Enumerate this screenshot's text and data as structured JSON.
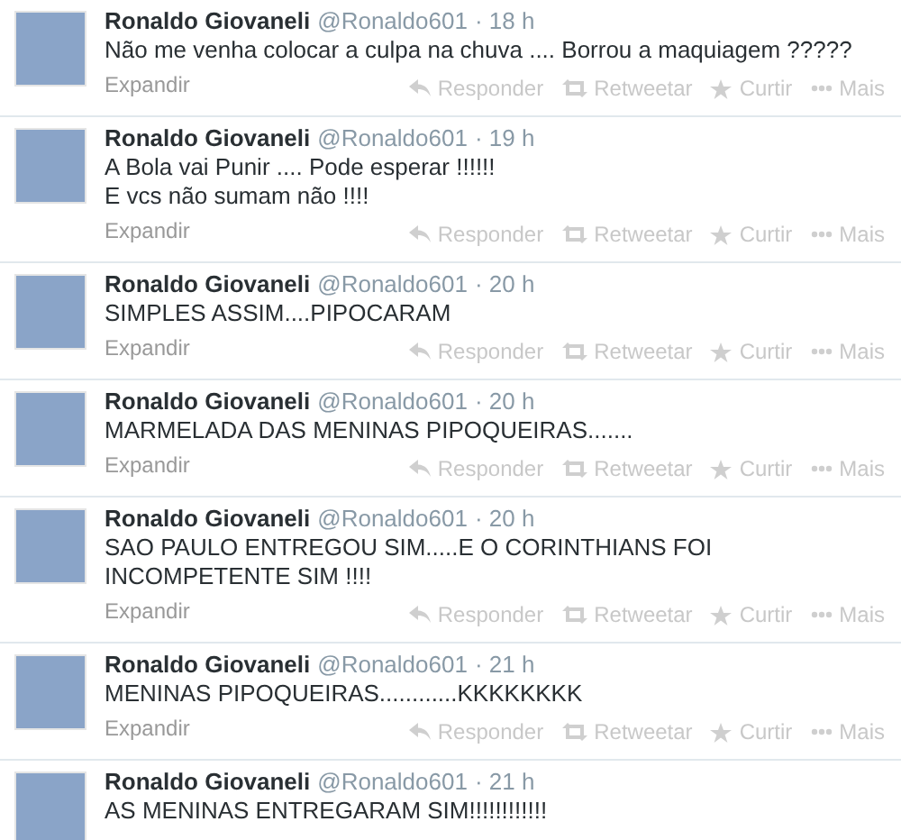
{
  "tweets": [
    {
      "name": "Ronaldo Giovaneli",
      "handle": "@Ronaldo601",
      "time": "· 18 h",
      "lines": [
        "Não me venha colocar a culpa na chuva .... Borrou a maquiagem ?????"
      ],
      "expand": "Expandir",
      "actions": [
        {
          "kind": "reply",
          "label": "Responder"
        },
        {
          "kind": "retweet",
          "label": "Retweetar"
        },
        {
          "kind": "like",
          "label": "Curtir"
        },
        {
          "kind": "more",
          "label": "Mais"
        }
      ]
    },
    {
      "name": "Ronaldo Giovaneli",
      "handle": "@Ronaldo601",
      "time": "· 19 h",
      "lines": [
        "A Bola vai Punir .... Pode esperar !!!!!!",
        "E vcs não sumam não !!!!"
      ],
      "expand": "Expandir",
      "actions": [
        {
          "kind": "reply",
          "label": "Responder"
        },
        {
          "kind": "retweet",
          "label": "Retweetar"
        },
        {
          "kind": "like",
          "label": "Curtir"
        },
        {
          "kind": "more",
          "label": "Mais"
        }
      ]
    },
    {
      "name": "Ronaldo Giovaneli",
      "handle": "@Ronaldo601",
      "time": "· 20 h",
      "lines": [
        "SIMPLES ASSIM....PIPOCARAM"
      ],
      "expand": "Expandir",
      "actions": [
        {
          "kind": "reply",
          "label": "Responder"
        },
        {
          "kind": "retweet",
          "label": "Retweetar"
        },
        {
          "kind": "like",
          "label": "Curtir"
        },
        {
          "kind": "more",
          "label": "Mais"
        }
      ]
    },
    {
      "name": "Ronaldo Giovaneli",
      "handle": "@Ronaldo601",
      "time": "· 20 h",
      "lines": [
        "MARMELADA DAS MENINAS PIPOQUEIRAS......."
      ],
      "expand": "Expandir",
      "actions": [
        {
          "kind": "reply",
          "label": "Responder"
        },
        {
          "kind": "retweet",
          "label": "Retweetar"
        },
        {
          "kind": "like",
          "label": "Curtir"
        },
        {
          "kind": "more",
          "label": "Mais"
        }
      ]
    },
    {
      "name": "Ronaldo Giovaneli",
      "handle": "@Ronaldo601",
      "time": "· 20 h",
      "lines": [
        "SAO PAULO ENTREGOU SIM.....E O CORINTHIANS FOI INCOMPETENTE SIM !!!!"
      ],
      "expand": "Expandir",
      "actions": [
        {
          "kind": "reply",
          "label": "Responder"
        },
        {
          "kind": "retweet",
          "label": "Retweetar"
        },
        {
          "kind": "like",
          "label": "Curtir"
        },
        {
          "kind": "more",
          "label": "Mais"
        }
      ]
    },
    {
      "name": "Ronaldo Giovaneli",
      "handle": "@Ronaldo601",
      "time": "· 21 h",
      "lines": [
        "MENINAS PIPOQUEIRAS............KKKKKKKK"
      ],
      "expand": "Expandir",
      "actions": [
        {
          "kind": "reply",
          "label": "Responder"
        },
        {
          "kind": "retweet",
          "label": "Retweetar"
        },
        {
          "kind": "like",
          "label": "Curtir"
        },
        {
          "kind": "more",
          "label": "Mais"
        }
      ]
    },
    {
      "name": "Ronaldo Giovaneli",
      "handle": "@Ronaldo601",
      "time": "· 21 h",
      "lines": [
        "AS MENINAS ENTREGARAM SIM!!!!!!!!!!!!"
      ]
    }
  ]
}
